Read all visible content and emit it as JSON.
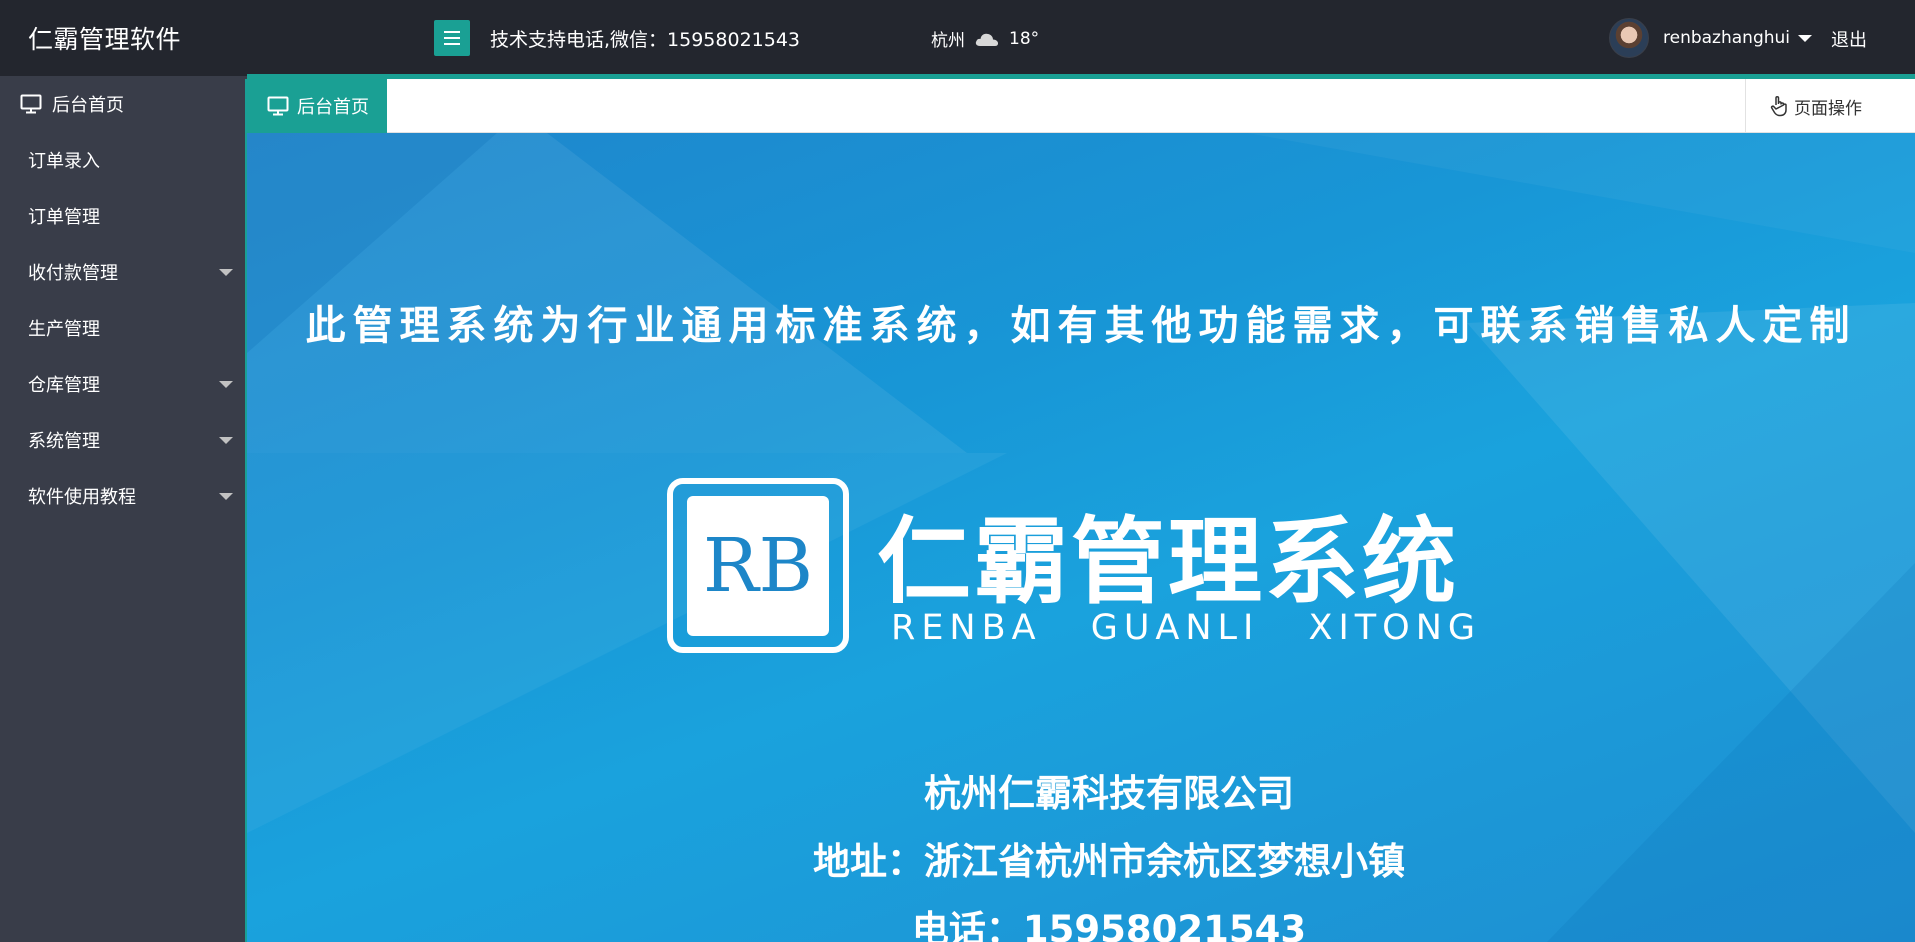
{
  "header": {
    "app_title": "仁霸管理软件",
    "menu_icon": "hamburger-menu-icon",
    "support_text": "技术支持电话,微信：15958021543",
    "weather": {
      "city": "杭州",
      "icon": "cloud-icon",
      "temperature": "18°"
    },
    "user": {
      "name": "renbazhanghui",
      "avatar": "user-avatar"
    },
    "logout_label": "退出"
  },
  "sidebar": {
    "items": [
      {
        "label": "后台首页",
        "icon": "monitor-icon",
        "has_submenu": false
      },
      {
        "label": "订单录入",
        "has_submenu": false
      },
      {
        "label": "订单管理",
        "has_submenu": false
      },
      {
        "label": "收付款管理",
        "has_submenu": true
      },
      {
        "label": "生产管理",
        "has_submenu": false
      },
      {
        "label": "仓库管理",
        "has_submenu": true
      },
      {
        "label": "系统管理",
        "has_submenu": true
      },
      {
        "label": "软件使用教程",
        "has_submenu": true
      }
    ]
  },
  "tabs": {
    "active": {
      "label": "后台首页",
      "icon": "monitor-icon"
    },
    "page_ops_label": "页面操作"
  },
  "banner": {
    "tagline": "此管理系统为行业通用标准系统，如有其他功能需求，可联系销售私人定制",
    "logo_letters": "RB",
    "brand_cn": "仁霸管理系统",
    "brand_en": "RENBA GUANLI XITONG",
    "company": "杭州仁霸科技有限公司",
    "address": "地址：浙江省杭州市余杭区梦想小镇",
    "phone": "电话：15958021543"
  },
  "colors": {
    "header_bg": "#23262e",
    "sidebar_bg": "#393d49",
    "accent": "#1aa094",
    "banner_blue": "#1896d6"
  }
}
